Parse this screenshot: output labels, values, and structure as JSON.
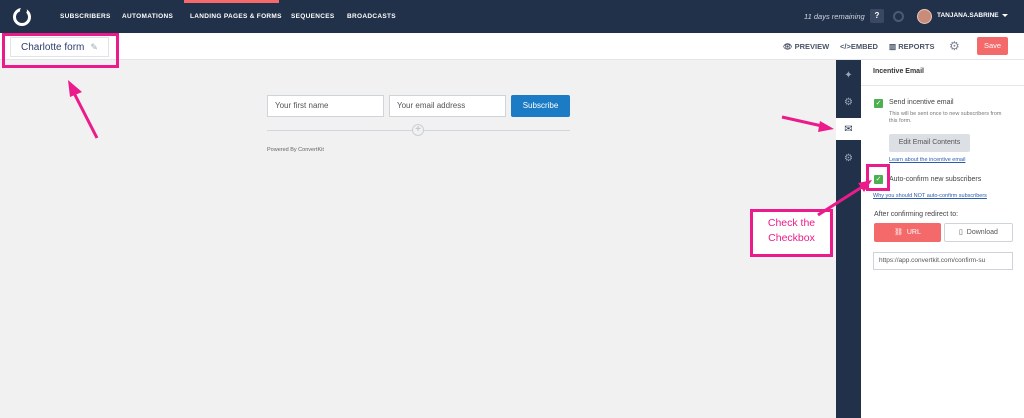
{
  "topnav": {
    "items": [
      "SUBSCRIBERS",
      "AUTOMATIONS",
      "LANDING PAGES & FORMS",
      "SEQUENCES",
      "BROADCASTS"
    ],
    "trial": "11 days remaining",
    "help": "?",
    "username": "TANJANA.SABRINE"
  },
  "toolbar": {
    "form_name": "Charlotte form",
    "preview": "PREVIEW",
    "embed": "EMBED",
    "reports": "REPORTS",
    "save": "Save"
  },
  "form_preview": {
    "first_name_placeholder": "Your first name",
    "email_placeholder": "Your email address",
    "subscribe": "Subscribe",
    "powered_by": "Powered By ConvertKit"
  },
  "panel": {
    "title": "Incentive Email",
    "send_incentive": "Send incentive email",
    "send_desc": "This will be sent once to new subscribers from this form.",
    "edit_btn": "Edit Email Contents",
    "learn_link": "Learn about the incentive email",
    "auto_confirm": "Auto-confirm new subscribers",
    "why_link": "Why you should NOT auto-confirm subscribers",
    "redirect_label": "After confirming redirect to:",
    "url_btn": "URL",
    "download_btn": "Download",
    "url_value": "https://app.convertkit.com/confirm-su"
  },
  "annotation": {
    "line1": "Check the",
    "line2": "Checkbox"
  },
  "colors": {
    "nav_bg": "#22314a",
    "accent_red": "#f46a6a",
    "subscribe_blue": "#1b7bc4",
    "annotation_pink": "#ec1b8b",
    "check_green": "#4caf50"
  }
}
